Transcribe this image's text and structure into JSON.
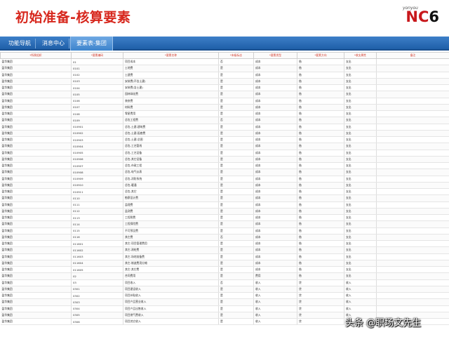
{
  "slide": {
    "title": "初始准备-核算要素"
  },
  "logo": {
    "small": "yonyou",
    "main_nc": "NC",
    "main_six": "6"
  },
  "tabs": [
    {
      "label": "功能导航"
    },
    {
      "label": "消息中心"
    },
    {
      "label": "要素表-集团"
    }
  ],
  "table": {
    "headers": [
      "*所属组织",
      "*要素编码",
      "*要素名称",
      "*末级标志",
      "*要素类型",
      "*要素方向",
      "*收支属性",
      "备注"
    ],
    "rows": [
      [
        "盈华集团",
        "01",
        "项目成本",
        "否",
        "成本",
        "借",
        "支出",
        ""
      ],
      [
        "盈华集团",
        "0101",
        "土地费",
        "是",
        "成本",
        "借",
        "支出",
        ""
      ],
      [
        "盈华集团",
        "0102",
        "土建费",
        "是",
        "成本",
        "借",
        "支出",
        ""
      ],
      [
        "盈华集团",
        "0103",
        "安装费(不含土建)",
        "是",
        "成本",
        "借",
        "支出",
        ""
      ],
      [
        "盈华集团",
        "0104",
        "安装费(含土建)",
        "是",
        "成本",
        "借",
        "支出",
        ""
      ],
      [
        "盈华集团",
        "0105",
        "园林绿化费",
        "是",
        "成本",
        "借",
        "支出",
        ""
      ],
      [
        "盈华集团",
        "0106",
        "装修费",
        "是",
        "成本",
        "借",
        "支出",
        ""
      ],
      [
        "盈华集团",
        "0107",
        "材料费",
        "是",
        "成本",
        "借",
        "支出",
        ""
      ],
      [
        "盈华集团",
        "0108",
        "零星费用",
        "是",
        "成本",
        "借",
        "支出",
        ""
      ],
      [
        "盈华集团",
        "0109",
        "总包工程费",
        "否",
        "成本",
        "借",
        "支出",
        ""
      ],
      [
        "盈华集团",
        "010901",
        "总包-土建-建筑费",
        "是",
        "成本",
        "借",
        "支出",
        ""
      ],
      [
        "盈华集团",
        "010902",
        "总包-土建-配套费",
        "是",
        "成本",
        "借",
        "支出",
        ""
      ],
      [
        "盈华集团",
        "010903",
        "总包-土建-总图",
        "是",
        "成本",
        "借",
        "支出",
        ""
      ],
      [
        "盈华集团",
        "010904",
        "总包-工艺管线",
        "是",
        "成本",
        "借",
        "支出",
        ""
      ],
      [
        "盈华集团",
        "010905",
        "总包-工艺设备",
        "是",
        "成本",
        "借",
        "支出",
        ""
      ],
      [
        "盈华集团",
        "010906",
        "总包-其它设备",
        "是",
        "成本",
        "借",
        "支出",
        ""
      ],
      [
        "盈华集团",
        "010907",
        "总包-市政工程",
        "是",
        "成本",
        "借",
        "支出",
        ""
      ],
      [
        "盈华集团",
        "010908",
        "总包-电气仪表",
        "是",
        "成本",
        "借",
        "支出",
        ""
      ],
      [
        "盈华集团",
        "010909",
        "总包-消防系统",
        "是",
        "成本",
        "借",
        "支出",
        ""
      ],
      [
        "盈华集团",
        "010910",
        "总包-暖通",
        "是",
        "成本",
        "借",
        "支出",
        ""
      ],
      [
        "盈华集团",
        "010911",
        "总包-其它",
        "是",
        "成本",
        "借",
        "支出",
        ""
      ],
      [
        "盈华集团",
        "0110",
        "勘察设计费",
        "是",
        "成本",
        "借",
        "支出",
        ""
      ],
      [
        "盈华集团",
        "0111",
        "监理费",
        "是",
        "成本",
        "借",
        "支出",
        ""
      ],
      [
        "盈华集团",
        "0112",
        "监测费",
        "是",
        "成本",
        "借",
        "支出",
        ""
      ],
      [
        "盈华集团",
        "0113",
        "工程税费",
        "是",
        "成本",
        "借",
        "支出",
        ""
      ],
      [
        "盈华集团",
        "0114",
        "工程保险费",
        "是",
        "成本",
        "借",
        "支出",
        ""
      ],
      [
        "盈华集团",
        "0115",
        "不可预见费",
        "是",
        "成本",
        "借",
        "支出",
        ""
      ],
      [
        "盈华集团",
        "0116",
        "其它费",
        "否",
        "成本",
        "借",
        "支出",
        ""
      ],
      [
        "盈华集团",
        "011601",
        "其它-项目管理费用",
        "是",
        "成本",
        "借",
        "支出",
        ""
      ],
      [
        "盈华集团",
        "011602",
        "其它-测绘费",
        "是",
        "成本",
        "借",
        "支出",
        ""
      ],
      [
        "盈华集团",
        "011603",
        "其它-场地准备费",
        "是",
        "成本",
        "借",
        "支出",
        ""
      ],
      [
        "盈华集团",
        "011604",
        "其它-制造费用分摊",
        "是",
        "成本",
        "借",
        "支出",
        ""
      ],
      [
        "盈华集团",
        "011605",
        "其它-其它费",
        "是",
        "成本",
        "借",
        "支出",
        ""
      ],
      [
        "盈华集团",
        "02",
        "合同费用",
        "是",
        "费用",
        "借",
        "支出",
        ""
      ],
      [
        "盈华集团",
        "03",
        "项目收入",
        "否",
        "收入",
        "贷",
        "收入",
        ""
      ],
      [
        "盈华集团",
        "0301",
        "项目建设收入",
        "是",
        "收入",
        "贷",
        "收入",
        ""
      ],
      [
        "盈华集团",
        "0302",
        "项目补贴收入",
        "是",
        "收入",
        "贷",
        "收入",
        ""
      ],
      [
        "盈华集团",
        "0303",
        "项目产品营业收入",
        "是",
        "收入",
        "贷",
        "收入",
        ""
      ],
      [
        "盈华集团",
        "0304",
        "项目产品出售收入",
        "是",
        "收入",
        "贷",
        "收入",
        ""
      ],
      [
        "盈华集团",
        "0305",
        "项目燃气费收入",
        "是",
        "收入",
        "贷",
        "收入",
        ""
      ],
      [
        "盈华集团",
        "0306",
        "项目其它收入",
        "是",
        "收入",
        "贷",
        "收入",
        ""
      ]
    ]
  },
  "watermark": {
    "text": "头条 @职场文先生"
  }
}
